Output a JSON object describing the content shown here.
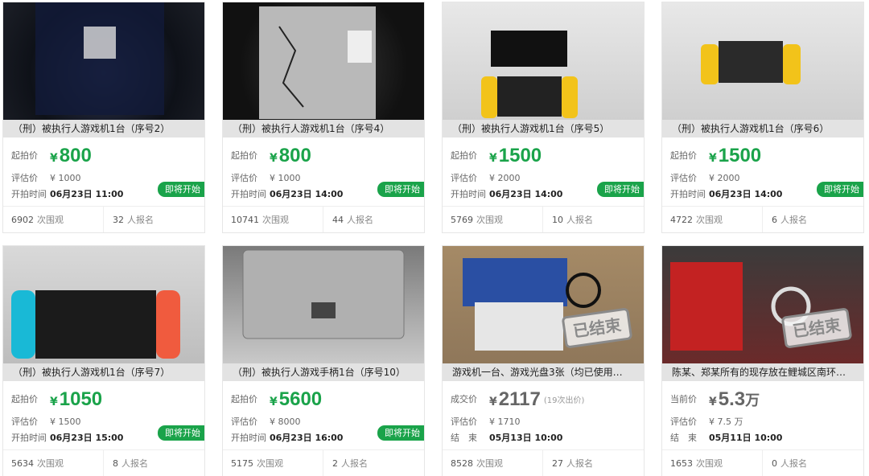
{
  "labels": {
    "start_price": "起拍价",
    "deal_price": "成交价",
    "current_price": "当前价",
    "estimate": "评估价",
    "start_time": "开拍时间",
    "end_time": "结　束",
    "yen": "¥",
    "viewers": "次围观",
    "signups": "人报名",
    "coming": "即将开始",
    "ended": "已结束"
  },
  "cards": [
    {
      "title": "（刑）被执行人游戏机1台（序号2）",
      "price": "800",
      "estimate": "¥ 1000",
      "time": "06月23日 11:00",
      "viewers": "6902",
      "signups": "32"
    },
    {
      "title": "（刑）被执行人游戏机1台（序号4）",
      "price": "800",
      "estimate": "¥ 1000",
      "time": "06月23日 14:00",
      "viewers": "10741",
      "signups": "44"
    },
    {
      "title": "（刑）被执行人游戏机1台（序号5）",
      "price": "1500",
      "estimate": "¥ 2000",
      "time": "06月23日 14:00",
      "viewers": "5769",
      "signups": "10"
    },
    {
      "title": "（刑）被执行人游戏机1台（序号6）",
      "price": "1500",
      "estimate": "¥ 2000",
      "time": "06月23日 14:00",
      "viewers": "4722",
      "signups": "6"
    },
    {
      "title": "（刑）被执行人游戏机1台（序号7）",
      "price": "1050",
      "estimate": "¥ 1500",
      "time": "06月23日 15:00",
      "viewers": "5634",
      "signups": "8"
    },
    {
      "title": "（刑）被执行人游戏手柄1台（序号10）",
      "price": "5600",
      "estimate": "¥ 8000",
      "time": "06月23日 16:00",
      "viewers": "5175",
      "signups": "2"
    },
    {
      "title": "游戏机一台、游戏光盘3张（均已使用…",
      "price": "2117",
      "bids": "(19次出价)",
      "estimate": "¥ 1710",
      "time": "05月13日 10:00",
      "viewers": "8528",
      "signups": "27"
    },
    {
      "title": "陈某、郑某所有的现存放在鲤城区南环…",
      "price": "5.3",
      "unit": "万",
      "estimate": "¥ 7.5 万",
      "time": "05月11日 10:00",
      "viewers": "1653",
      "signups": "0"
    }
  ]
}
